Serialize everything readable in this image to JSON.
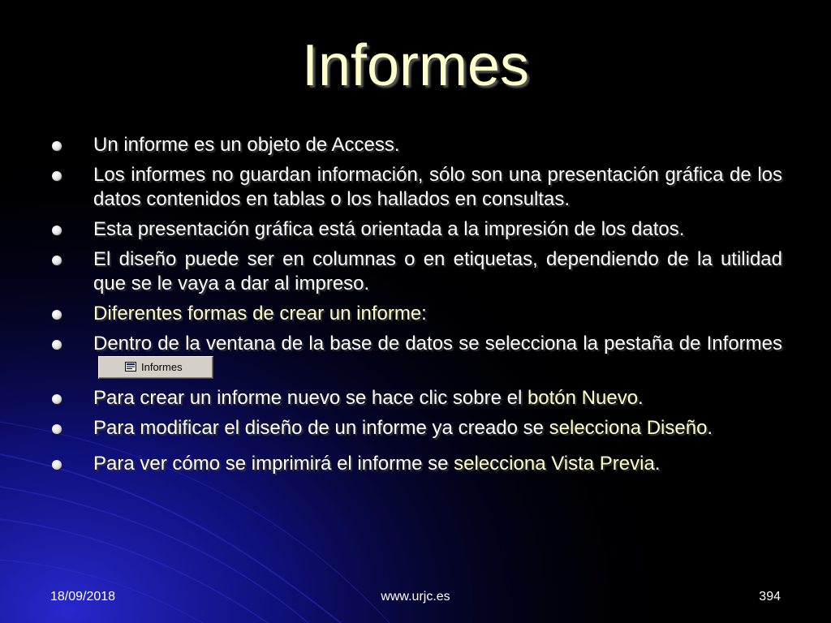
{
  "slide": {
    "title": "Informes",
    "bullets": [
      {
        "segments": [
          {
            "text": "Un informe es un objeto de Access.",
            "highlight": false
          }
        ]
      },
      {
        "segments": [
          {
            "text": "Los informes no guardan información, sólo son una presentación gráfica de los datos contenidos en tablas o los hallados en consultas.",
            "highlight": false
          }
        ]
      },
      {
        "segments": [
          {
            "text": "Esta presentación gráfica está orientada a la impresión de los datos.",
            "highlight": false
          }
        ]
      },
      {
        "segments": [
          {
            "text": "El diseño puede ser en columnas o en etiquetas, dependiendo de la utilidad que se le vaya a dar al impreso.",
            "highlight": false
          }
        ]
      },
      {
        "segments": [
          {
            "text": "Diferentes formas de crear un informe",
            "highlight": true
          },
          {
            "text": ":",
            "highlight": false
          }
        ]
      },
      {
        "segments": [
          {
            "text": "Dentro de la ventana de la base de datos se selecciona la pestaña de Informes",
            "highlight": false
          }
        ],
        "has_button": true
      },
      {
        "segments": [
          {
            "text": "Para crear un informe nuevo se hace clic sobre el ",
            "highlight": false
          },
          {
            "text": "botón Nuevo",
            "highlight": true
          },
          {
            "text": ".",
            "highlight": false
          }
        ]
      },
      {
        "segments": [
          {
            "text": "Para modificar el diseño de un informe ya creado se ",
            "highlight": false
          },
          {
            "text": "selecciona Diseño",
            "highlight": true
          },
          {
            "text": ".",
            "highlight": false
          }
        ]
      },
      {
        "segments": [
          {
            "text": "Para ver cómo se imprimirá el informe se ",
            "highlight": false
          },
          {
            "text": "selecciona Vista Previa",
            "highlight": true
          },
          {
            "text": ".",
            "highlight": false
          }
        ],
        "gap_before": true
      }
    ],
    "tab_button": {
      "label": "Informes",
      "icon": "report-icon"
    }
  },
  "footer": {
    "date": "18/09/2018",
    "site": "www.urjc.es",
    "page": "394"
  },
  "colors": {
    "background": "#000000",
    "title": "#ffffcc",
    "text": "#ffffff",
    "highlight": "#ffffcc",
    "glow": "#1a1aa8"
  }
}
